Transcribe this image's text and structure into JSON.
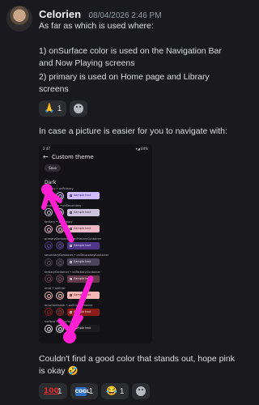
{
  "message": {
    "username": "Celorien",
    "timestamp": "08/04/2026 2:46 PM",
    "text_intro": "As far as which is used where:",
    "text_line1": "1) onSurface color is used on the Navigation Bar and Now Playing screens",
    "text_line2": "2) primary is used on Home page and Library screens",
    "text_picture": "In case a picture is easier for you to navigate with:",
    "text_outro": "Couldn't find a good color that stands out, hope pink is okay 🤣"
  },
  "reactions_top": [
    {
      "emoji": "🙏",
      "count": "1"
    }
  ],
  "reactions_bottom": [
    {
      "emoji": "100",
      "count": "1"
    },
    {
      "emoji": "COOL",
      "count": "1"
    },
    {
      "emoji": "😂",
      "count": "1"
    }
  ],
  "screenshot": {
    "status_time": "2:47",
    "status_right": "▾◢ 64%",
    "back_icon": "←",
    "title": "Custom theme",
    "save_label": "Save",
    "section": "Dark",
    "sample_text": "Sample text",
    "rows": [
      {
        "label": "primary • onPrimary",
        "ring": "#d0bcff",
        "chip_bg": "#d0bcff",
        "chip_fg": "#381e72"
      },
      {
        "label": "secondary • onSecondary",
        "ring": "#ccc2dc",
        "chip_bg": "#ccc2dc",
        "chip_fg": "#332d41"
      },
      {
        "label": "tertiary • onTertiary",
        "ring": "#efb8c8",
        "chip_bg": "#efb8c8",
        "chip_fg": "#492532"
      },
      {
        "label": "primaryContainer • onPrimaryContainer",
        "ring": "#4f378b",
        "chip_bg": "#4f378b",
        "chip_fg": "#eaddff"
      },
      {
        "label": "secondaryContainer • onSecondaryContainer",
        "ring": "#4a4458",
        "chip_bg": "#4a4458",
        "chip_fg": "#e8def8"
      },
      {
        "label": "tertiaryContainer • onTertiaryContainer",
        "ring": "#633b48",
        "chip_bg": "#633b48",
        "chip_fg": "#ffd8e4"
      },
      {
        "label": "error • onError",
        "ring": "#f2b8b5",
        "chip_bg": "#f2b8b5",
        "chip_fg": "#601410"
      },
      {
        "label": "errorContainer • onErrorContainer",
        "ring": "#8c1d18",
        "chip_bg": "#8c1d18",
        "chip_fg": "#f9dedc"
      },
      {
        "label": "surface • onSurface",
        "ring": "#e6e1e5",
        "chip_bg": "#1c1b1f",
        "chip_fg": "#e6e1e5"
      }
    ]
  },
  "colors": {
    "background": "#1a1a1e",
    "text": "#dbdee1",
    "timestamp": "#949ba4",
    "reaction_bg": "#2b2d31",
    "annotation": "#ff1fd2"
  }
}
